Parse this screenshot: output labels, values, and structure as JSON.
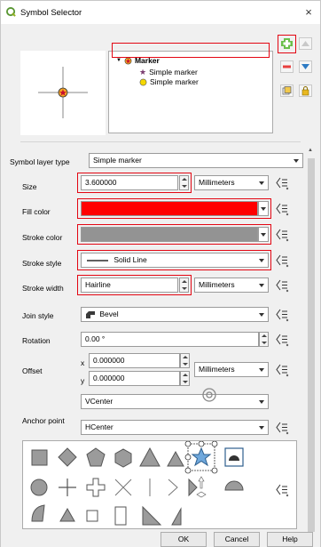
{
  "window": {
    "title": "Symbol Selector",
    "close_glyph": "×"
  },
  "tree": {
    "root_label": "Marker",
    "children": [
      "Simple marker",
      "Simple marker"
    ]
  },
  "labels": {
    "symbol_layer_type": "Symbol layer type",
    "size": "Size",
    "fill_color": "Fill color",
    "stroke_color": "Stroke color",
    "stroke_style": "Stroke style",
    "stroke_width": "Stroke width",
    "join_style": "Join style",
    "rotation": "Rotation",
    "offset": "Offset",
    "anchor_point": "Anchor point",
    "x": "x",
    "y": "y"
  },
  "values": {
    "symbol_layer_type": "Simple marker",
    "size": "3.600000",
    "size_unit": "Millimeters",
    "stroke_style": "Solid Line",
    "stroke_width": "Hairline",
    "stroke_width_unit": "Millimeters",
    "join_style": "Bevel",
    "rotation": "0.00 °",
    "offset_x": "0.000000",
    "offset_y": "0.000000",
    "offset_unit": "Millimeters",
    "anchor_v": "VCenter",
    "anchor_h": "HCenter"
  },
  "colors": {
    "fill": "#ff0000",
    "stroke": "#939393",
    "highlight": "#e30613",
    "marker_orange": "#f5a623"
  },
  "buttons": {
    "ok": "OK",
    "cancel": "Cancel",
    "help": "Help"
  }
}
